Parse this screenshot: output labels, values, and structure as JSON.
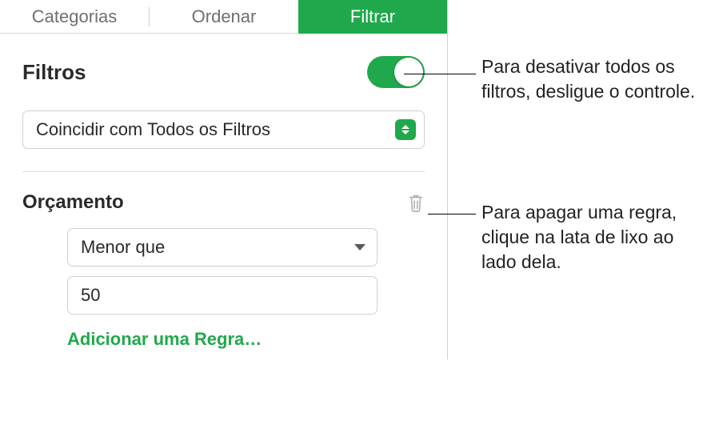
{
  "tabs": {
    "categories": "Categorias",
    "sort": "Ordenar",
    "filter": "Filtrar"
  },
  "heading": "Filtros",
  "matchSelect": "Coincidir com Todos os Filtros",
  "rule": {
    "column": "Orçamento",
    "comparator": "Menor que",
    "value": "50",
    "addRule": "Adicionar uma Regra…"
  },
  "callouts": {
    "toggle": "Para desativar todos os filtros, desligue o controle.",
    "trash": "Para apagar uma regra, clique na lata de lixo ao lado dela."
  }
}
